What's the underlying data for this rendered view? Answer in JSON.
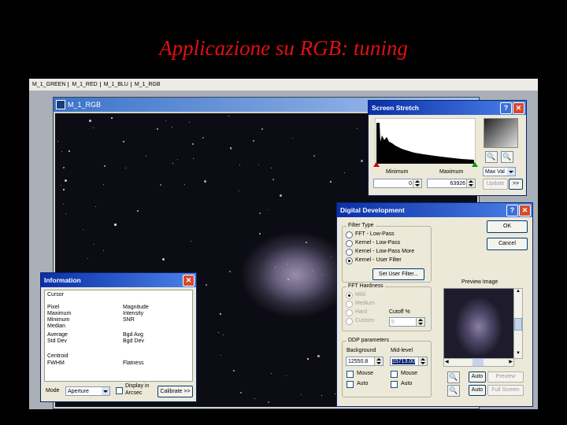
{
  "slide": {
    "title": "Applicazione su RGB: tuning"
  },
  "doc_tabs": [
    "M_1_GREEN",
    "M_1_RED",
    "M_1_BLU",
    "M_1_RGB"
  ],
  "image_window": {
    "title": "M_1_RGB"
  },
  "screen_stretch": {
    "title": "Screen Stretch",
    "minimum_label": "Minimum",
    "maximum_label": "Maximum",
    "minimum_value": "0",
    "maximum_value": "63926",
    "mode_select": "Max Val",
    "update_button": "Update",
    "more_button": ">>"
  },
  "information": {
    "title": "Information",
    "cursor_label": "Cursor",
    "left_labels": [
      "Pixel",
      "Maximum",
      "Minimum",
      "Median",
      "Average",
      "Std Dev"
    ],
    "right_labels": [
      "Magnitude",
      "Intensity",
      "SNR",
      "",
      "Bgd Avg",
      "Bgd Dev"
    ],
    "centroid_label": "Centroid",
    "fwhm_label": "FWHM",
    "flatness_label": "Flatness",
    "mode_label": "Mode",
    "mode_value": "Aperture",
    "display_arcsec_line1": "Display in",
    "display_arcsec_line2": "Arcsec",
    "calibrate_button": "Calibrate >>"
  },
  "digital_development": {
    "title": "Digital Development",
    "filter_type_caption": "Filter Type",
    "filter_options": [
      "FFT - Low-Pass",
      "Kernel - Low-Pass",
      "Kernel - Low-Pass More",
      "Kernel - User Filter"
    ],
    "selected_filter": "Kernel - User Filter",
    "set_user_filter_button": "Set User Filter...",
    "ok_button": "OK",
    "cancel_button": "Cancel",
    "preview_image_label": "Preview Image",
    "fft_hardness_caption": "FFT Hardness",
    "hardness_options": [
      "Mild",
      "Medium",
      "Hard",
      "Custom"
    ],
    "cutoff_label": "Cutoff %",
    "cutoff_value": "5",
    "ddp_caption": "DDP parameters",
    "background_label": "Background",
    "midlevel_label": "Mid-level",
    "background_value": "12550.8",
    "midlevel_value": "15713.00",
    "mouse_label": "Mouse",
    "auto_label": "Auto",
    "zoom_auto_button": "Auto",
    "preview_button": "Preview",
    "full_screen_button": "Full Screen"
  }
}
